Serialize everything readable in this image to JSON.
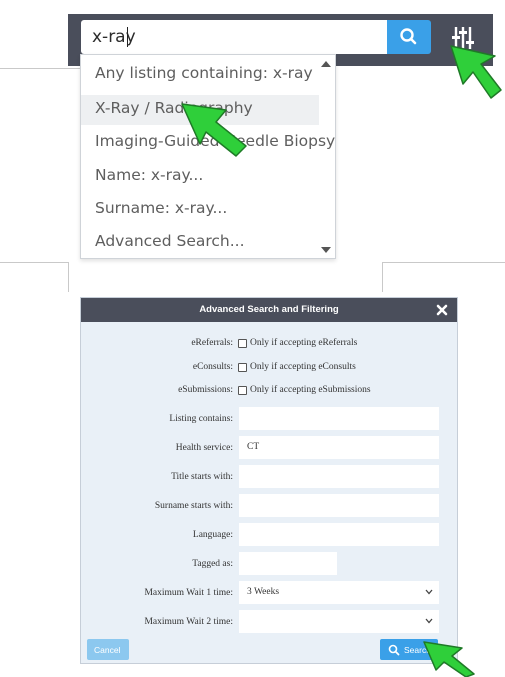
{
  "search": {
    "value": "x-ray",
    "button_icon": "search-icon",
    "filter_icon": "sliders-icon"
  },
  "dropdown": {
    "items": [
      "Any listing containing: x-ray",
      "X-Ray / Radiography",
      "Imaging-Guided Needle Biopsy",
      "Name: x-ray...",
      "Surname: x-ray...",
      "Advanced Search..."
    ],
    "highlighted_index": 1
  },
  "modal": {
    "title": "Advanced Search and Filtering",
    "close_icon": "close-icon",
    "checkboxes": [
      {
        "label": "eReferrals:",
        "text": "Only if accepting eReferrals",
        "checked": false
      },
      {
        "label": "eConsults:",
        "text": "Only if accepting eConsults",
        "checked": false
      },
      {
        "label": "eSubmissions:",
        "text": "Only if accepting eSubmissions",
        "checked": false
      }
    ],
    "fields": [
      {
        "label": "Listing contains:",
        "value": ""
      },
      {
        "label": "Health service:",
        "value": "CT"
      },
      {
        "label": "Title starts with:",
        "value": ""
      },
      {
        "label": "Surname starts with:",
        "value": ""
      },
      {
        "label": "Language:",
        "value": ""
      },
      {
        "label": "Tagged as:",
        "value": ""
      }
    ],
    "selects": [
      {
        "label": "Maximum Wait 1 time:",
        "value": "3 Weeks"
      },
      {
        "label": "Maximum Wait 2 time:",
        "value": ""
      }
    ],
    "cancel_label": "Cancel",
    "search_label": "Search"
  },
  "colors": {
    "header": "#4a4e5b",
    "accent": "#3aa0e8",
    "modal_bg": "#e9f0f7",
    "cursor": "#2fcf3a"
  }
}
